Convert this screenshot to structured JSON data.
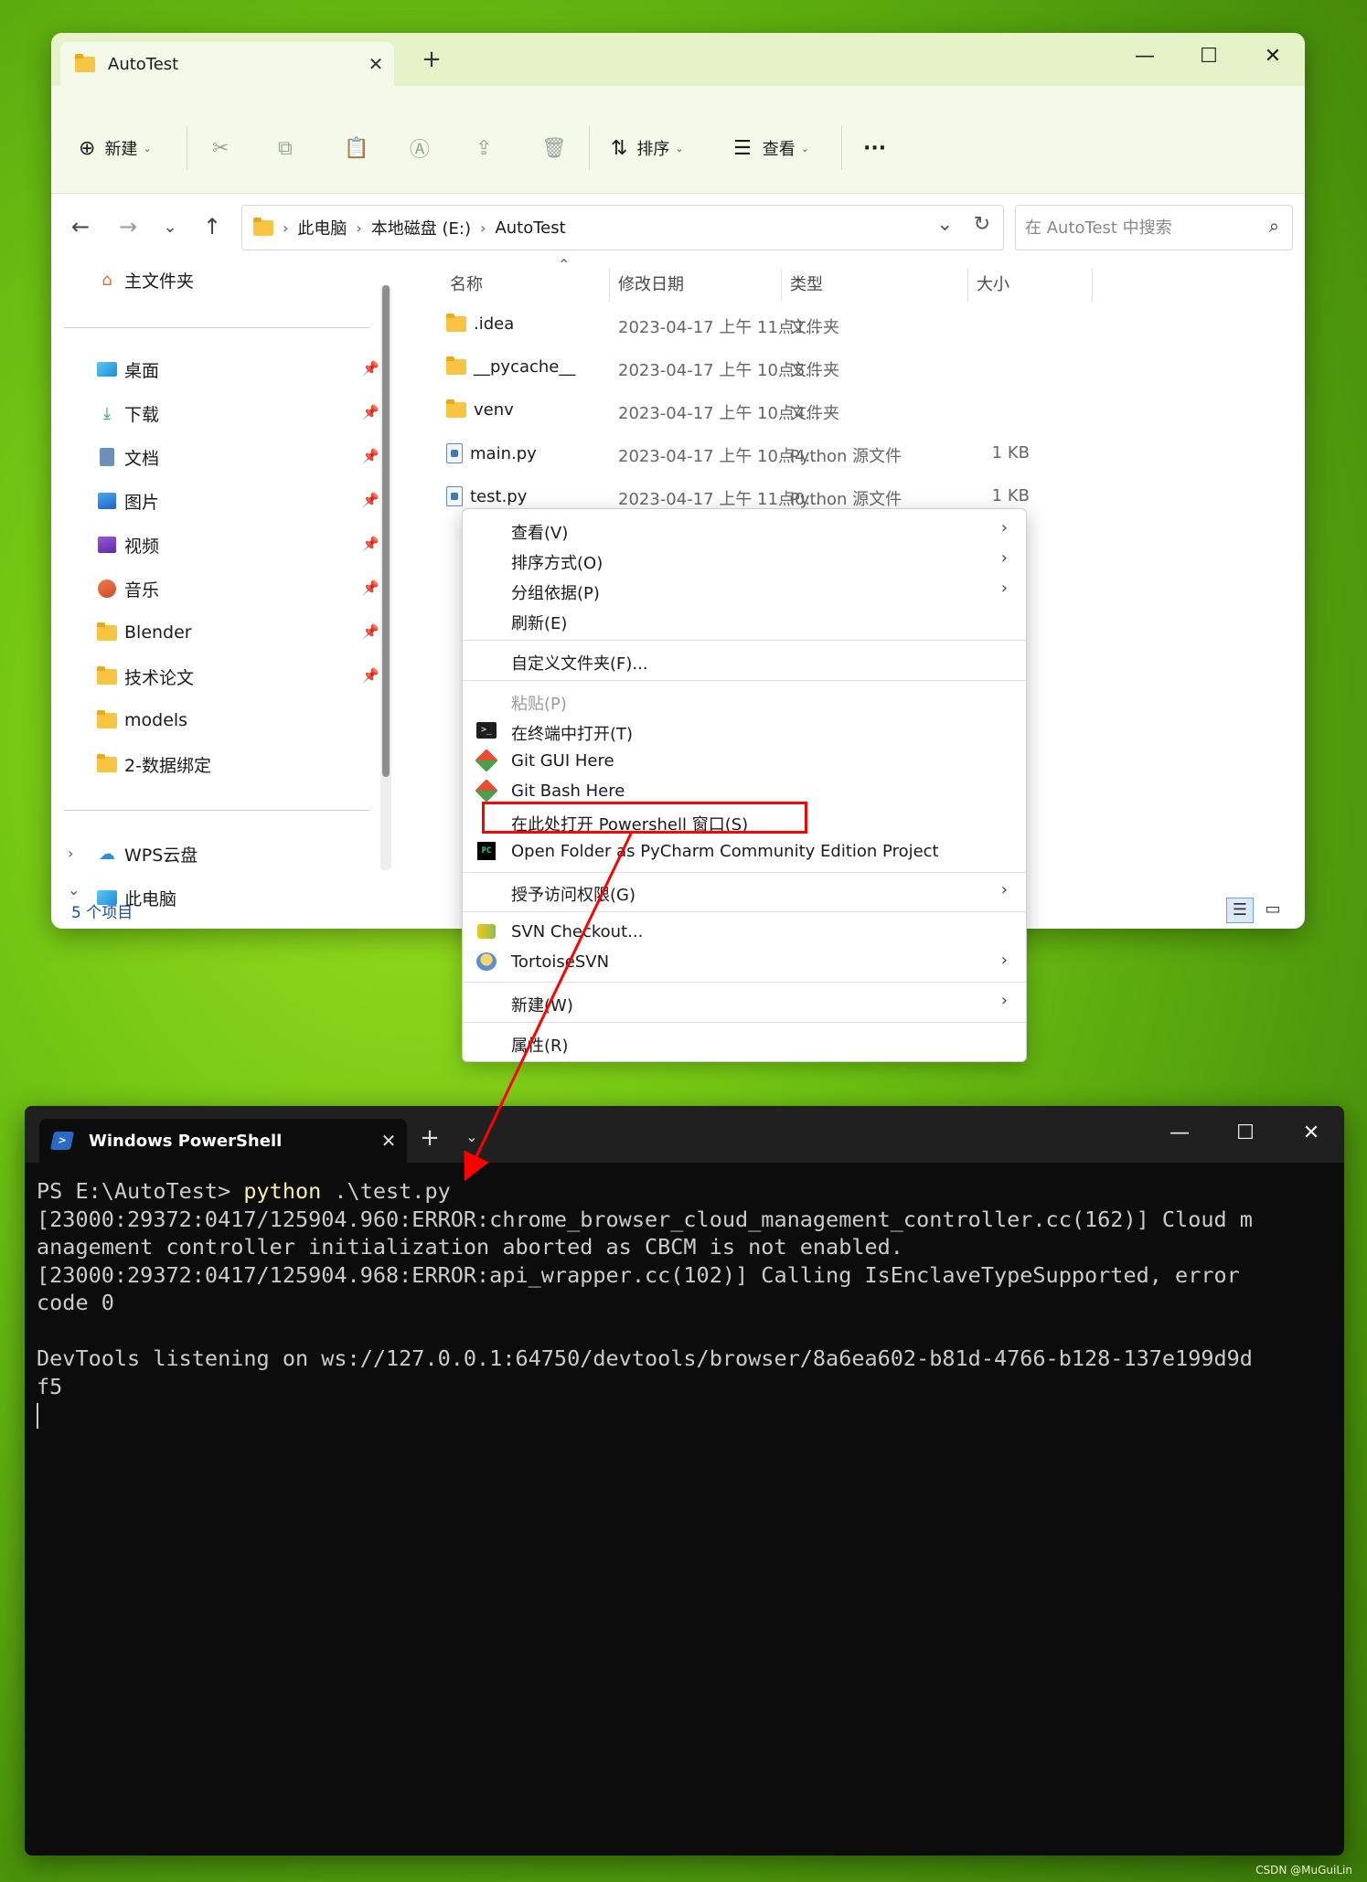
{
  "explorer": {
    "tab_title": "AutoTest",
    "toolbar": {
      "new_label": "新建",
      "sort_label": "排序",
      "view_label": "查看",
      "more": "···"
    },
    "breadcrumb": [
      "此电脑",
      "本地磁盘 (E:)",
      "AutoTest"
    ],
    "search_placeholder": "在 AutoTest 中搜索",
    "sidebar": {
      "home": "主文件夹",
      "pinned": [
        {
          "label": "桌面",
          "icon": "desktop-icon"
        },
        {
          "label": "下载",
          "icon": "download-icon"
        },
        {
          "label": "文档",
          "icon": "document-icon"
        },
        {
          "label": "图片",
          "icon": "pictures-icon"
        },
        {
          "label": "视频",
          "icon": "video-icon"
        },
        {
          "label": "音乐",
          "icon": "music-icon"
        },
        {
          "label": "Blender",
          "icon": "folder-icon"
        },
        {
          "label": "技术论文",
          "icon": "folder-icon"
        },
        {
          "label": "models",
          "icon": "folder-icon"
        },
        {
          "label": "2-数据绑定",
          "icon": "folder-icon"
        }
      ],
      "wps": "WPS云盘",
      "this_pc": "此电脑"
    },
    "columns": {
      "name": "名称",
      "date": "修改日期",
      "type": "类型",
      "size": "大小"
    },
    "files": [
      {
        "name": ".idea",
        "date": "2023-04-17 上午 11点1...",
        "type": "文件夹",
        "size": "",
        "kind": "folder"
      },
      {
        "name": "__pycache__",
        "date": "2023-04-17 上午 10点5...",
        "type": "文件夹",
        "size": "",
        "kind": "folder"
      },
      {
        "name": "venv",
        "date": "2023-04-17 上午 10点4...",
        "type": "文件夹",
        "size": "",
        "kind": "folder"
      },
      {
        "name": "main.py",
        "date": "2023-04-17 上午 10点4...",
        "type": "Python 源文件",
        "size": "1 KB",
        "kind": "py"
      },
      {
        "name": "test.py",
        "date": "2023-04-17 上午 11点0...",
        "type": "Python 源文件",
        "size": "1 KB",
        "kind": "py"
      }
    ],
    "status": "5 个项目"
  },
  "context_menu": {
    "items": {
      "view": "查看(V)",
      "sort": "排序方式(O)",
      "group": "分组依据(P)",
      "refresh": "刷新(E)",
      "customize": "自定义文件夹(F)...",
      "paste": "粘贴(P)",
      "terminal": "在终端中打开(T)",
      "git_gui": "Git GUI Here",
      "git_bash": "Git Bash Here",
      "powershell": "在此处打开 Powershell 窗口(S)",
      "pycharm": "Open Folder as PyCharm Community Edition Project",
      "grant": "授予访问权限(G)",
      "svn_checkout": "SVN Checkout...",
      "tortoise": "TortoiseSVN",
      "new": "新建(W)",
      "properties": "属性(R)"
    }
  },
  "powershell": {
    "tab_title": "Windows PowerShell",
    "prompt": "PS E:\\AutoTest> ",
    "command": "python",
    "command_arg": " .\\test.py",
    "lines": [
      "[23000:29372:0417/125904.960:ERROR:chrome_browser_cloud_management_controller.cc(162)] Cloud m",
      "anagement controller initialization aborted as CBCM is not enabled.",
      "[23000:29372:0417/125904.968:ERROR:api_wrapper.cc(102)] Calling IsEnclaveTypeSupported, error",
      "code 0",
      "",
      "DevTools listening on ws://127.0.0.1:64750/devtools/browser/8a6ea602-b81d-4766-b128-137e199d9d",
      "f5"
    ]
  },
  "watermark": "CSDN @MuGuiLin",
  "colors": {
    "accent_green": "#e6f3c8",
    "highlight_red": "#ff0000",
    "terminal_bg": "#0c0c0c"
  }
}
